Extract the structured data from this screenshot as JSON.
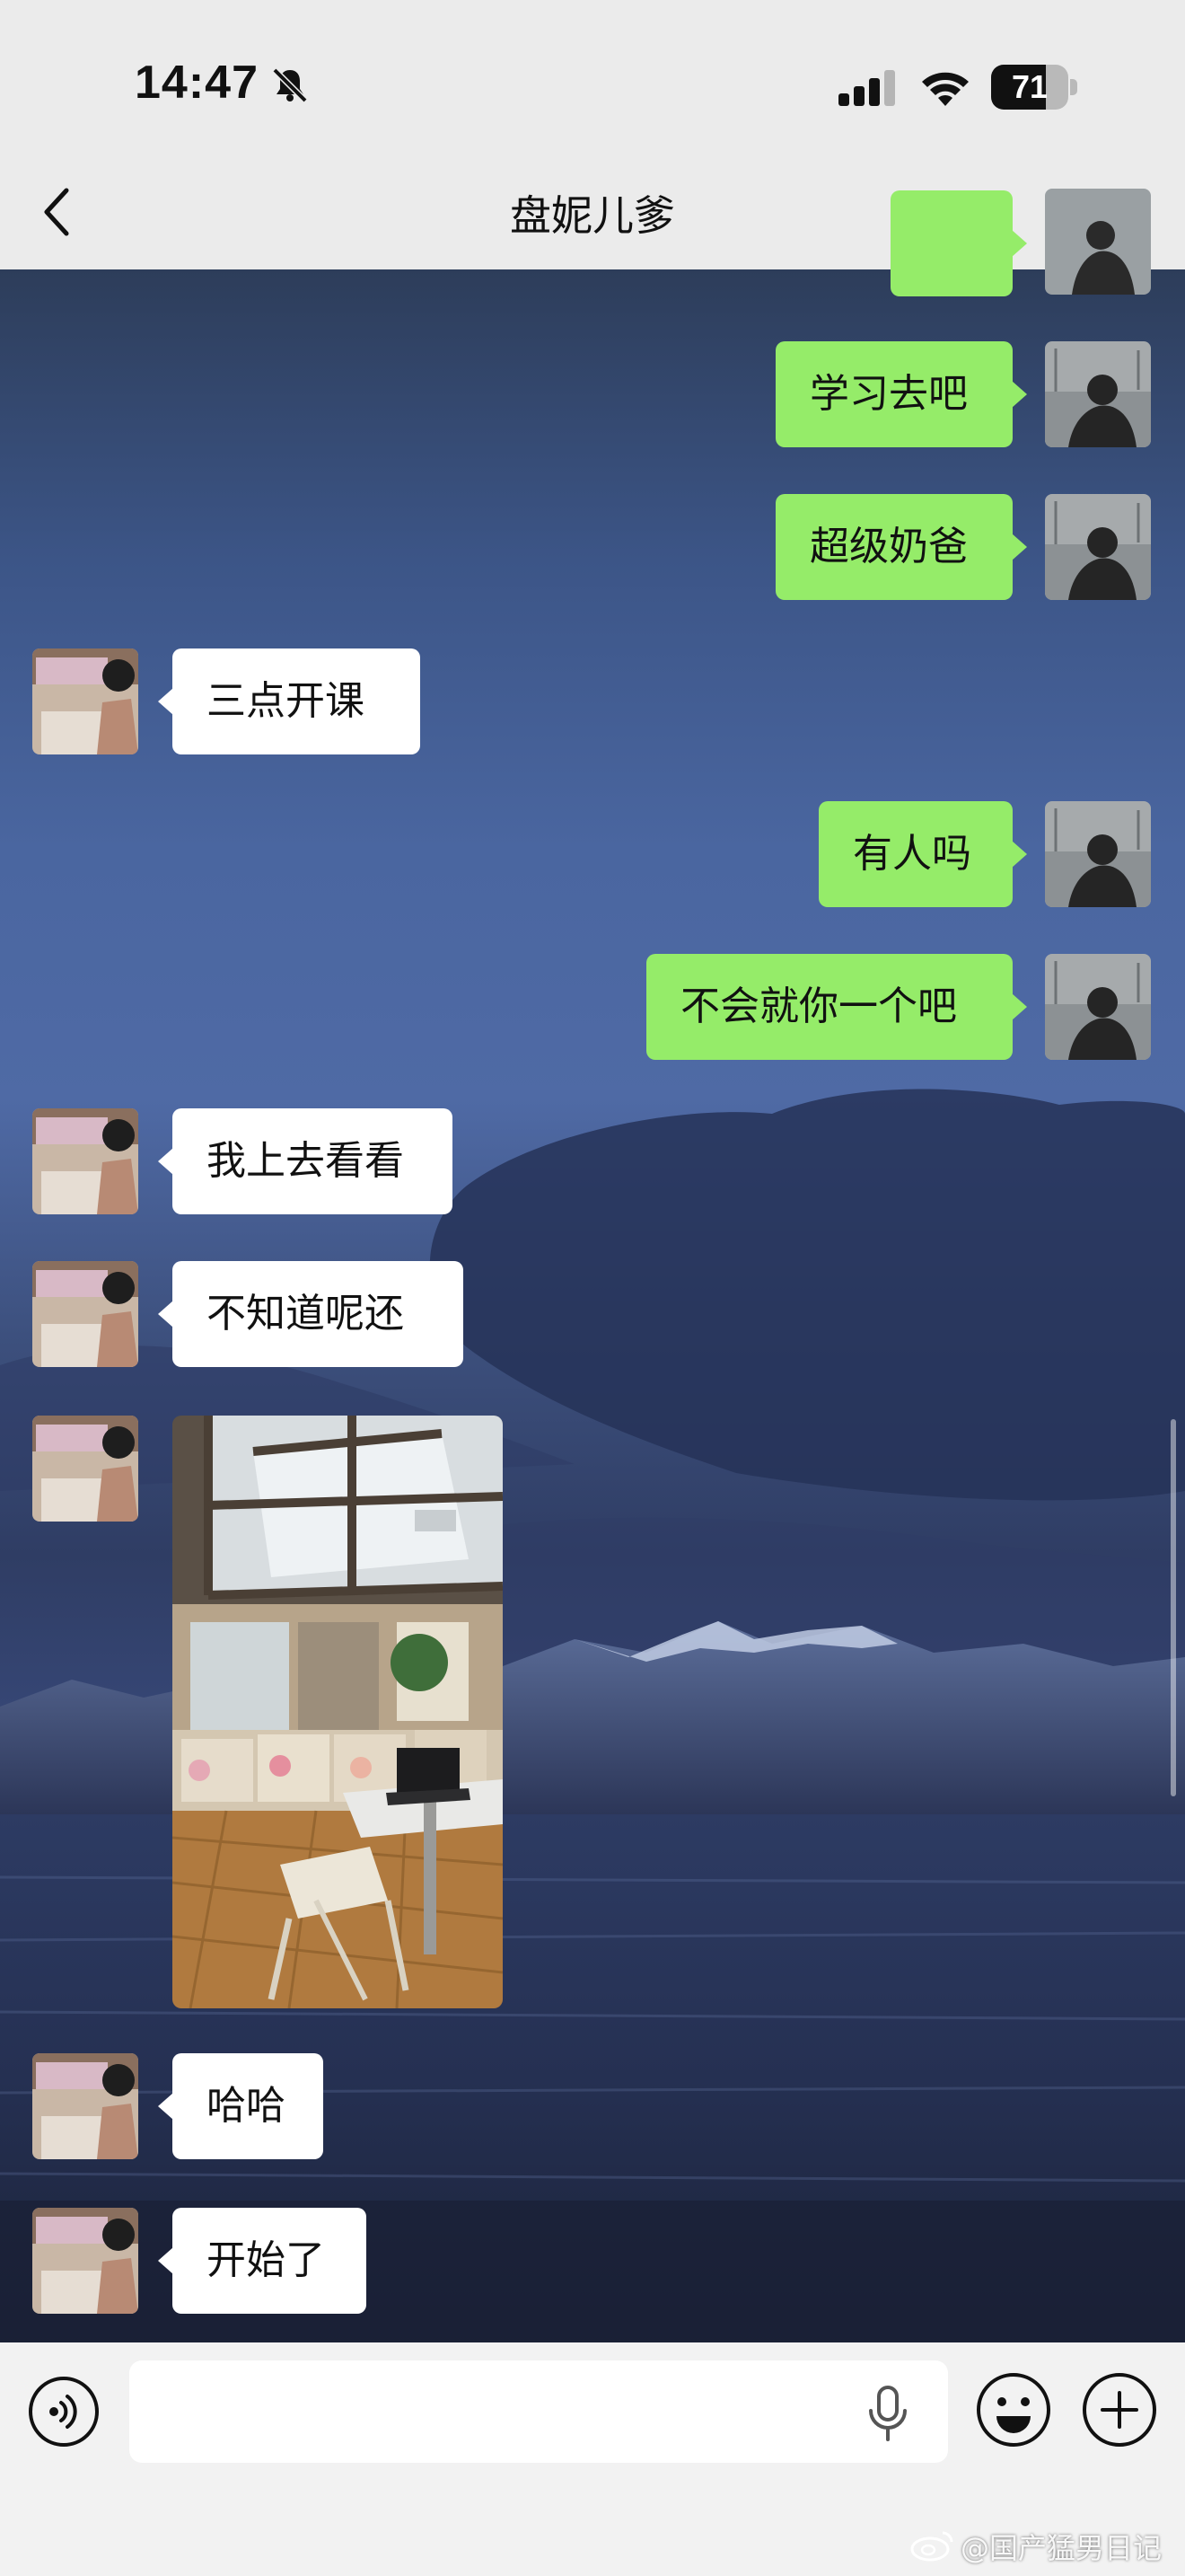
{
  "status_bar": {
    "time": "14:47",
    "battery_level": "71",
    "battery_fraction": 0.71,
    "icons": [
      "bell-off-icon",
      "cell-signal-icon",
      "wifi-icon",
      "battery-icon"
    ]
  },
  "nav": {
    "title": "盘妮儿爹",
    "back_icon": "chevron-left-icon",
    "more_icon": "ellipsis-icon"
  },
  "messages": [
    {
      "side": "right",
      "type": "text",
      "text": "学习去吧"
    },
    {
      "side": "right",
      "type": "text",
      "text": "超级奶爸"
    },
    {
      "side": "left",
      "type": "text",
      "text": "三点开课"
    },
    {
      "side": "right",
      "type": "text",
      "text": "有人吗"
    },
    {
      "side": "right",
      "type": "text",
      "text": "不会就你一个吧"
    },
    {
      "side": "left",
      "type": "text",
      "text": "我上去看看"
    },
    {
      "side": "left",
      "type": "text",
      "text": "不知道呢还"
    },
    {
      "side": "left",
      "type": "image",
      "image": "classroom-photo"
    },
    {
      "side": "left",
      "type": "text",
      "text": "哈哈"
    },
    {
      "side": "left",
      "type": "text",
      "text": "开始了"
    }
  ],
  "input_bar": {
    "placeholder": "",
    "icons": [
      "voice-icon",
      "mic-icon",
      "emoji-icon",
      "plus-icon"
    ]
  },
  "watermark": {
    "text": "@国产猛男日记",
    "icon": "weibo-icon"
  },
  "colors": {
    "sent_bubble": "#95ec69",
    "received_bubble": "#ffffff",
    "nav_background": "#ebebeb",
    "input_bar_background": "#f2f2f2"
  }
}
